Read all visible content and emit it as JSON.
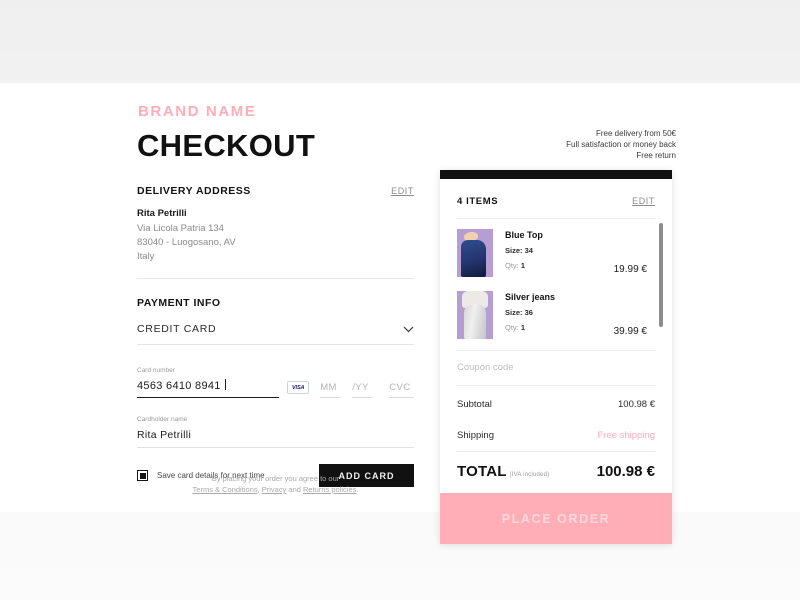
{
  "header": {
    "brand": "BRAND NAME",
    "title": "CHECKOUT",
    "promo_lines": [
      "Free delivery from 50€",
      "Full satisfaction or money back",
      "Free return"
    ]
  },
  "delivery": {
    "title": "DELIVERY ADDRESS",
    "edit_label": "EDIT",
    "name": "Rita Petrilli",
    "street": "Via Licola Patria 134",
    "city": "83040 - Luogosano, AV",
    "country": "Italy"
  },
  "payment": {
    "title": "PAYMENT INFO",
    "method_selected": "CREDIT CARD",
    "method_options": [
      "CREDIT CARD"
    ],
    "card_number_label": "Card number",
    "card_number_value": "4563 6410 8941",
    "card_brand": "VISA",
    "expiry_month_placeholder": "MM",
    "expiry_year_placeholder": "/YY",
    "cvc_placeholder": "CVC",
    "cardholder_label": "Cardholder name",
    "cardholder_value": "Rita Petrilli",
    "save_card_label": "Save card details for next time",
    "save_card_checked": true,
    "add_card_label": "ADD CARD"
  },
  "terms": {
    "line1": "By placing your order you agree to our",
    "link1": "Terms & Conditions",
    "sep1": ", ",
    "link2": "Privacy",
    "sep2": " and ",
    "link3": "Returns policies",
    "end": "."
  },
  "summary": {
    "items_count_label": "4 ITEMS",
    "edit_label": "EDIT",
    "items": [
      {
        "name": "Blue Top",
        "size_label": "Size: 34",
        "qty_label": "Qty:",
        "qty_value": "1",
        "price": "19.99 €",
        "thumb": "blue-top"
      },
      {
        "name": "Silver jeans",
        "size_label": "Size: 36",
        "qty_label": "Qty:",
        "qty_value": "1",
        "price": "39.99 €",
        "thumb": "silver-jeans"
      }
    ],
    "coupon_placeholder": "Coupon code",
    "subtotal_label": "Subtotal",
    "subtotal_value": "100.98 €",
    "shipping_label": "Shipping",
    "shipping_value": "Free shipping",
    "total_label": "TOTAL",
    "total_note": "(IVA included)",
    "total_value": "100.98 €",
    "place_order_label": "PLACE ORDER"
  },
  "colors": {
    "accent_pink": "#ffadb6",
    "dark": "#111111",
    "muted": "#9b9b9b"
  }
}
